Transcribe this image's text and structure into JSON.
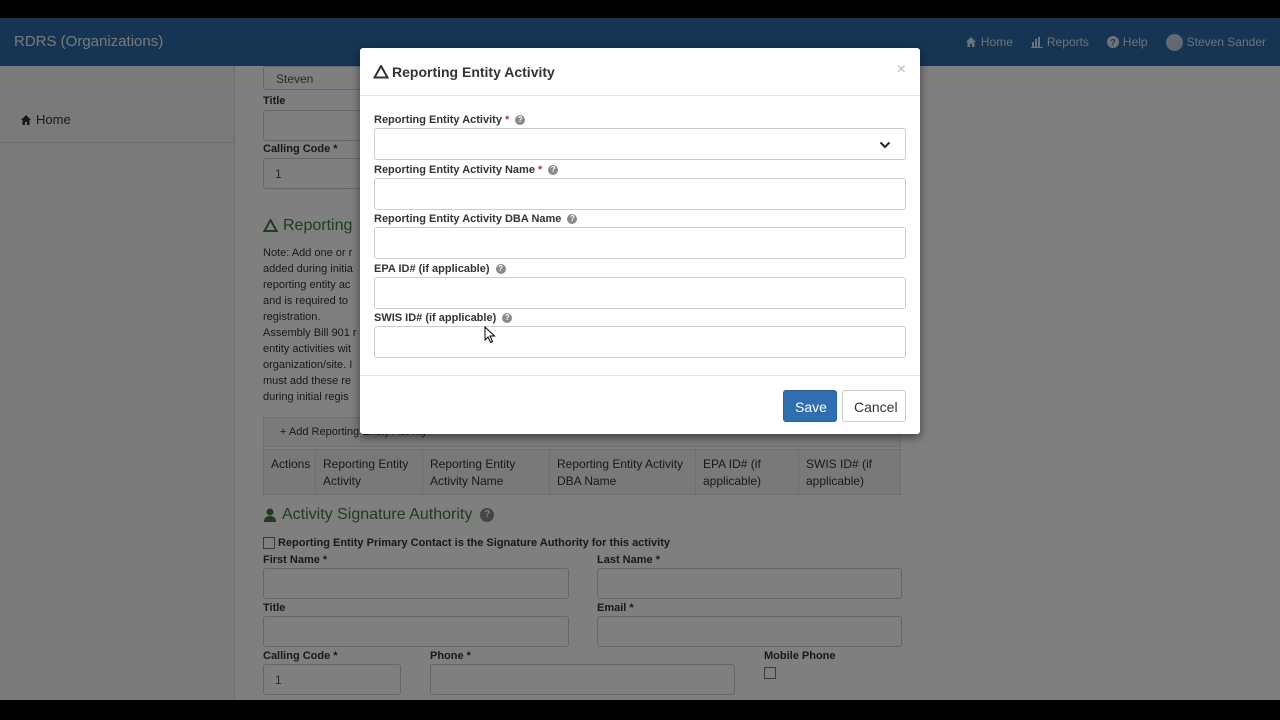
{
  "navbar": {
    "brand": "RDRS (Organizations)",
    "home_label": "Home",
    "reports_label": "Reports",
    "help_label": "Help",
    "user_name": "Steven Sander"
  },
  "sidebar": {
    "home_label": "Home"
  },
  "background": {
    "first_name_value": "Steven",
    "title_label": "Title",
    "calling_code_label": "Calling Code *",
    "calling_code_value": "1",
    "section_title": "Reporting",
    "note_text": "Note: Add one or r\nadded during initia\nreporting entity ac\nand is required to\nregistration.\nAssembly Bill 901 r\nentity activities wit\norganization/site. I\nmust add these re\nduring initial regis",
    "add_button_label": "Add Reporting Entity Activity",
    "table_headers": [
      "Actions",
      "Reporting Entity Activity",
      "Reporting Entity Activity Name",
      "Reporting Entity Activity DBA Name",
      "EPA ID# (if applicable)",
      "SWIS ID# (if applicable)"
    ],
    "signature_title": "Activity Signature Authority",
    "checkbox_label": "Reporting Entity Primary Contact is the Signature Authority for this activity",
    "first_name_label": "First Name *",
    "last_name_label": "Last Name *",
    "title2_label": "Title",
    "email_label": "Email *",
    "calling_code2_label": "Calling Code *",
    "calling_code2_value": "1",
    "phone_label": "Phone *",
    "mobile_label": "Mobile Phone"
  },
  "modal": {
    "title": "Reporting Entity Activity",
    "close_glyph": "×",
    "fields": {
      "activity_label": "Reporting Entity Activity",
      "activity_name_label": "Reporting Entity Activity Name",
      "dba_label": "Reporting Entity Activity DBA Name",
      "epa_label": "EPA ID# (if applicable)",
      "swis_label": "SWIS ID# (if applicable)",
      "required_marker": "*"
    },
    "save_label": "Save",
    "cancel_label": "Cancel"
  },
  "colors": {
    "navbar": "#2c6aa6",
    "section_green": "#3c7a3c",
    "primary_button": "#2f6fb0"
  },
  "icons": [
    "home-icon",
    "reports-icon",
    "help-icon",
    "avatar",
    "recycle-icon",
    "user-icon",
    "chevron-down-icon",
    "plus-icon",
    "close-icon"
  ]
}
